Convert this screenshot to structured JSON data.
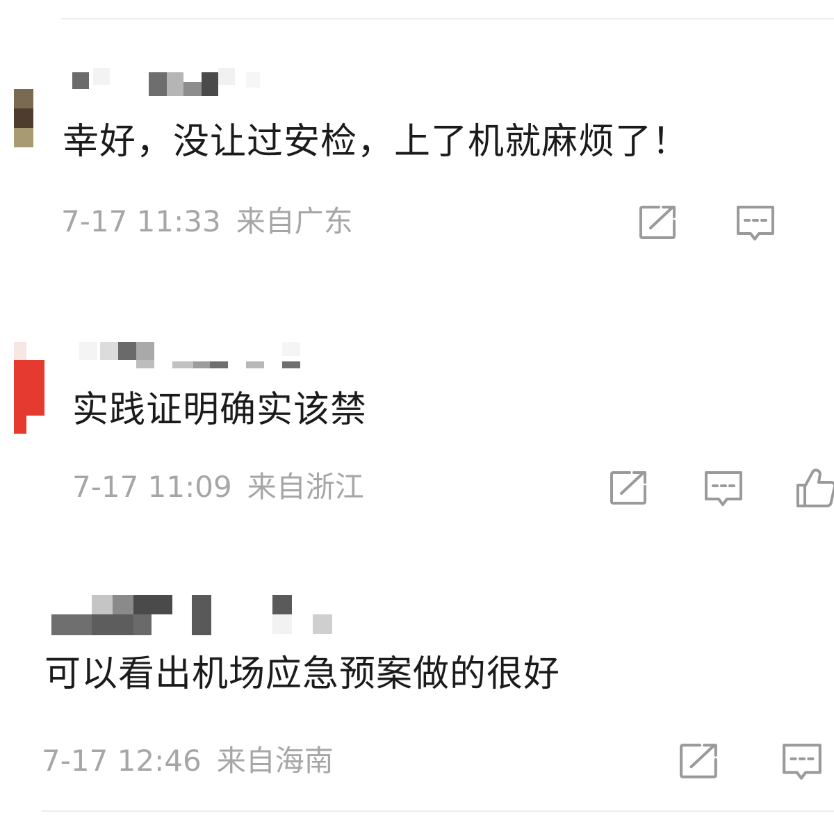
{
  "comments": [
    {
      "text": "幸好，没让过安检，上了机就麻烦了！",
      "time": "7-17 11:33",
      "location": "来自广东"
    },
    {
      "text": "实践证明确实该禁",
      "time": "7-17 11:09",
      "location": "来自浙江"
    },
    {
      "text": "可以看出机场应急预案做的很好",
      "time": "7-17 12:46",
      "location": "来自海南"
    }
  ],
  "icons": {
    "share": "share-icon",
    "reply": "comment-icon",
    "like": "thumbs-up-icon"
  },
  "colors": {
    "text": "#1b1b1b",
    "meta": "#a6a6a6",
    "icon": "#9a9a9a",
    "avatar_red": "#e53a2f"
  }
}
